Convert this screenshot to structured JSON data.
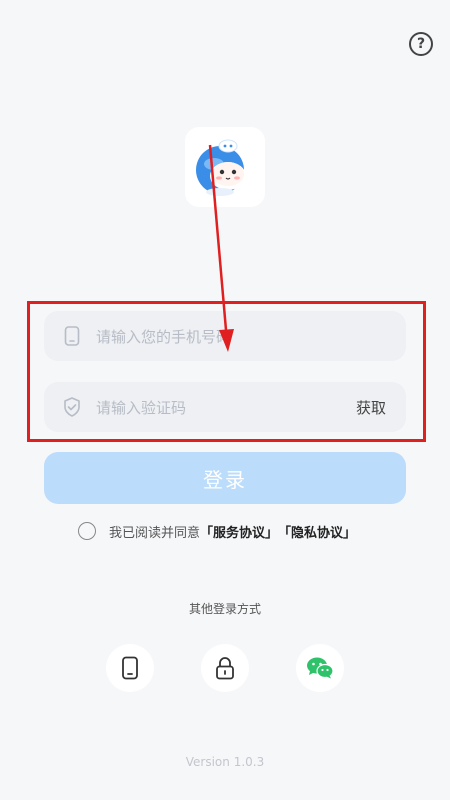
{
  "header": {
    "help_icon": "question-circle-icon",
    "help_glyph": "?"
  },
  "logo": {
    "icon": "mascot-logo-icon"
  },
  "phone_field": {
    "icon": "phone-icon",
    "placeholder": "请输入您的手机号码"
  },
  "code_field": {
    "icon": "shield-check-icon",
    "placeholder": "请输入验证码",
    "get_code_label": "获取"
  },
  "login_button": {
    "label": "登录"
  },
  "agreement": {
    "prefix": "我已阅读并同意",
    "service_link": "「服务协议」",
    "privacy_link": "「隐私协议」"
  },
  "other_login": {
    "label": "其他登录方式",
    "methods": [
      {
        "icon": "phone-icon"
      },
      {
        "icon": "lock-icon"
      },
      {
        "icon": "wechat-icon"
      }
    ]
  },
  "version": "Version 1.0.3",
  "colors": {
    "accent": "#bcdcfb",
    "annotation": "#e02020",
    "wechat": "#2fc26b"
  }
}
